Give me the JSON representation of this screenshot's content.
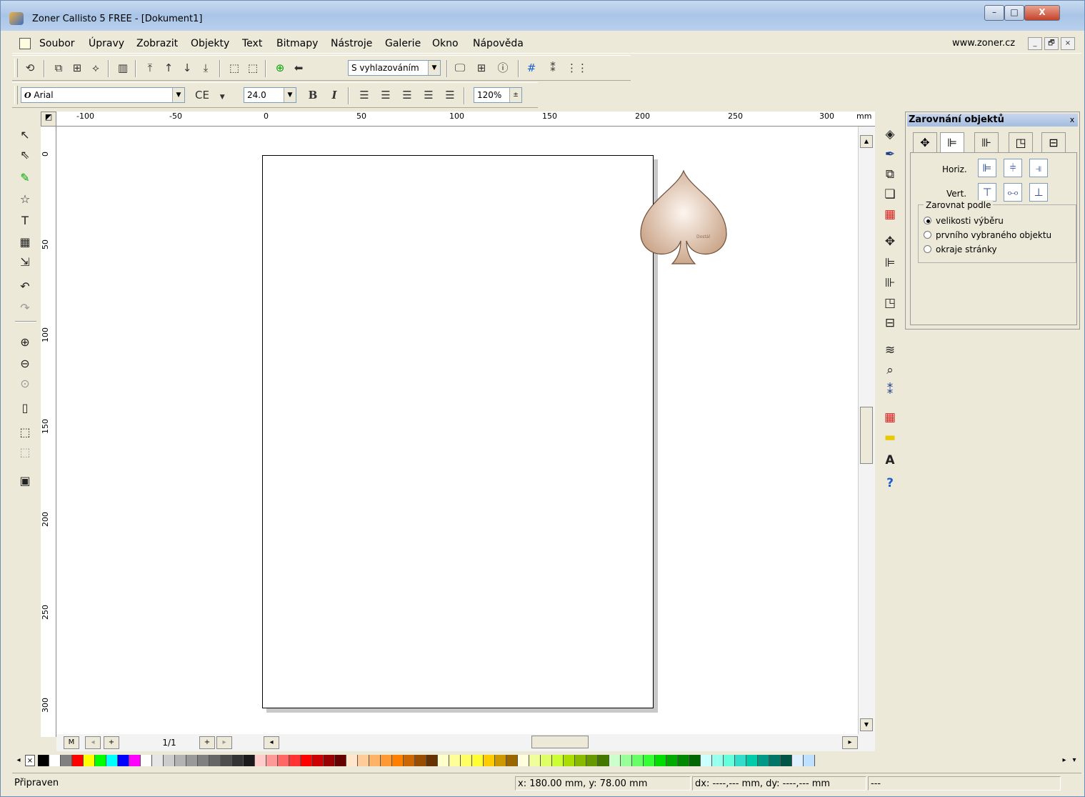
{
  "window": {
    "title": "Zoner Callisto 5 FREE - [Dokument1]",
    "min": "–",
    "max": "□",
    "close": "X"
  },
  "menu": {
    "items": [
      "Soubor",
      "Úpravy",
      "Zobrazit",
      "Objekty",
      "Text",
      "Bitmapy",
      "Nástroje",
      "Galerie",
      "Okno",
      "Nápověda"
    ],
    "website": "www.zoner.cz",
    "mdi_min": "_",
    "mdi_restore": "🗗",
    "mdi_close": "×"
  },
  "toolbar1": {
    "smoothing_mode": "S vyhlazováním",
    "icons": [
      "refresh-icon",
      "group-icon",
      "ungroup-icon",
      "combine-icon",
      "columns-icon",
      "to-front-icon",
      "forward-icon",
      "backward-icon",
      "to-back-icon",
      "transform-icon",
      "transform2-icon",
      "add-object-icon",
      "remove-icon"
    ]
  },
  "toolbar2": {
    "font": "Arial",
    "font_prefix": "O",
    "charset": "CE",
    "size": "24.0",
    "bold": "B",
    "italic": "I",
    "zoom": "120%"
  },
  "rulers": {
    "unit": "mm",
    "h_ticks": [
      "-100",
      "-50",
      "0",
      "50",
      "100",
      "150",
      "200",
      "250",
      "300"
    ],
    "v_ticks": [
      "0",
      "50",
      "100",
      "150",
      "200",
      "250",
      "300"
    ]
  },
  "pages": {
    "current": "1/1",
    "first": "M",
    "add": "+"
  },
  "panel": {
    "title": "Zarovnání objektů",
    "close": "x",
    "horiz_label": "Horiz.",
    "vert_label": "Vert.",
    "group_label": "Zarovnat podle",
    "options": [
      "velikosti výběru",
      "prvního vybraného objektu",
      "okraje stránky"
    ],
    "selected_option": 0
  },
  "canvas": {
    "spade_label": "Dostál",
    "spade_color": "#c8a184"
  },
  "palette": {
    "colors": [
      "#000000",
      "#ffffff",
      "#808080",
      "#ff0000",
      "#ffff00",
      "#00ff00",
      "#00ffff",
      "#0000ff",
      "#ff00ff",
      "#ffffff",
      "#e6e6e6",
      "#cccccc",
      "#b3b3b3",
      "#999999",
      "#808080",
      "#666666",
      "#4d4d4d",
      "#333333",
      "#1a1a1a",
      "#ffcccc",
      "#ff9999",
      "#ff6666",
      "#ff3333",
      "#ff0000",
      "#cc0000",
      "#990000",
      "#660000",
      "#ffe6cc",
      "#ffcc99",
      "#ffb366",
      "#ff9933",
      "#ff8000",
      "#cc6600",
      "#994d00",
      "#663300",
      "#ffffcc",
      "#ffff99",
      "#ffff66",
      "#ffff33",
      "#ffcc00",
      "#cc9900",
      "#996600",
      "#ffffe0",
      "#f0ff99",
      "#e0ff66",
      "#ccff33",
      "#aadd00",
      "#88bb00",
      "#669900",
      "#447700",
      "#ccffcc",
      "#99ff99",
      "#66ff66",
      "#33ff33",
      "#00dd00",
      "#00aa00",
      "#008800",
      "#006600",
      "#ccffff",
      "#99ffee",
      "#66ffdd",
      "#33ddcc",
      "#00ccaa",
      "#009988",
      "#007766",
      "#005544",
      "#e0f0ff",
      "#c0e0ff"
    ]
  },
  "status": {
    "ready": "Připraven",
    "coords": "x: 180.00 mm, y: 78.00 mm",
    "delta": "dx: ----,--- mm, dy: ----,--- mm",
    "extra": "---"
  }
}
